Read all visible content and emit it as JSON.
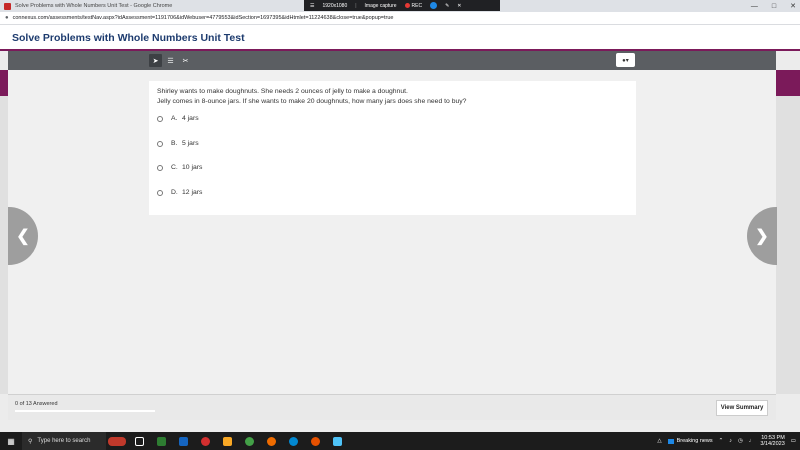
{
  "browser": {
    "tab_title": "Solve Problems with Whole Numbers Unit Test - Google Chrome",
    "url": "connexus.com/assessments/testNav.aspx?idAssessment=1191706&idWebuser=4779553&idSection=1697395&idHtmlet=11224638&close=true&popup=true"
  },
  "capture_bar": {
    "resolution": "1920x1080",
    "label": "Image capture",
    "rec_label": "REC"
  },
  "page": {
    "title": "Solve Problems with Whole Numbers Unit Test"
  },
  "question": {
    "line1": "Shirley wants to make doughnuts. She needs 2 ounces of jelly to make a doughnut.",
    "line2": "Jelly comes in 8-ounce jars. If she wants to make 20 doughnuts, how many jars does she need to buy?",
    "choices": [
      {
        "letter": "A.",
        "text": "4 jars"
      },
      {
        "letter": "B.",
        "text": "5 jars"
      },
      {
        "letter": "C.",
        "text": "10 jars"
      },
      {
        "letter": "D.",
        "text": "12 jars"
      }
    ]
  },
  "footer": {
    "answered": "0 of 13 Answered",
    "progress": 0,
    "summary_button": "View Summary"
  },
  "taskbar": {
    "search_placeholder": "Type here to search",
    "news": "Breaking news",
    "time": "10:53 PM",
    "date": "3/14/2023"
  },
  "colors": {
    "accent": "#7b1a5a",
    "title": "#1d3b6e",
    "toolbar": "#5b5e62"
  }
}
